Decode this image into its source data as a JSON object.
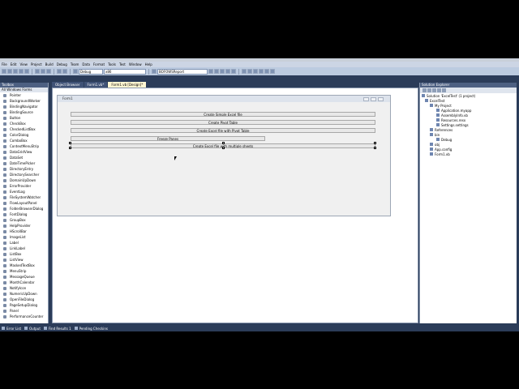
{
  "menu": [
    "File",
    "Edit",
    "View",
    "Project",
    "Build",
    "Debug",
    "Team",
    "Data",
    "Format",
    "Tools",
    "Test",
    "Window",
    "Help"
  ],
  "toolbar": {
    "config": "Debug",
    "platform": "x86",
    "search": "BOFOWSReport"
  },
  "toolbox": {
    "title": "Toolbox",
    "group": "All Windows Forms",
    "items": [
      "Pointer",
      "BackgroundWorker",
      "BindingNavigator",
      "BindingSource",
      "Button",
      "CheckBox",
      "CheckedListBox",
      "ColorDialog",
      "ComboBox",
      "ContextMenuStrip",
      "DataGridView",
      "DataSet",
      "DateTimePicker",
      "DirectoryEntry",
      "DirectorySearcher",
      "DomainUpDown",
      "ErrorProvider",
      "EventLog",
      "FileSystemWatcher",
      "FlowLayoutPanel",
      "FolderBrowserDialog",
      "FontDialog",
      "GroupBox",
      "HelpProvider",
      "HScrollBar",
      "ImageList",
      "Label",
      "LinkLabel",
      "ListBox",
      "ListView",
      "MaskedTextBox",
      "MenuStrip",
      "MessageQueue",
      "MonthCalendar",
      "NotifyIcon",
      "NumericUpDown",
      "OpenFileDialog",
      "PageSetupDialog",
      "Panel",
      "PerformanceCounter"
    ]
  },
  "tabs": [
    "Object Browser",
    "Form1.vb*",
    "Form1.vb [Design]*"
  ],
  "form": {
    "title": "Form1",
    "buttons": [
      "Create Simple Excel file",
      "Create Pivot Table",
      "Create Excel file with Pivot Table",
      "Freeze Panes",
      "Create Excel file with multiple sheets"
    ]
  },
  "solution": {
    "title": "Solution Explorer",
    "items": [
      "Solution 'ExcelTest' (1 project)",
      "ExcelTest",
      "My Project",
      "Application.myapp",
      "AssemblyInfo.vb",
      "Resources.resx",
      "Settings.settings",
      "References",
      "bin",
      "Debug",
      "obj",
      "App.config",
      "Form1.vb"
    ]
  },
  "bottom_tabs": [
    "Error List",
    "Output",
    "Find Results 1",
    "Pending Checkins"
  ]
}
